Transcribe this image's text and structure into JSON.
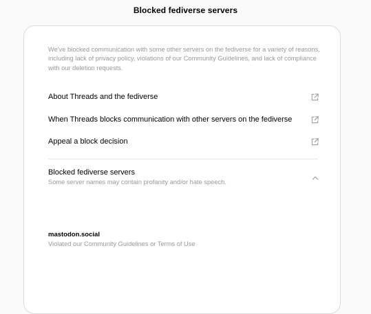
{
  "header": {
    "title": "Blocked fediverse servers"
  },
  "intro": "We've blocked communication with some other servers on the fediverse for a variety of reasons, including lack of privacy policy, violations of our Community Guidelines, and lack of compliance with our deletion requests.",
  "links": [
    {
      "label": "About Threads and the fediverse",
      "icon": "external-link-icon"
    },
    {
      "label": "When Threads blocks communication with other servers on the fediverse",
      "icon": "external-link-icon"
    },
    {
      "label": "Appeal a block decision",
      "icon": "external-link-icon"
    }
  ],
  "blocked_section": {
    "title": "Blocked fediverse servers",
    "subtitle": "Some server names may contain profanity and/or hate speech.",
    "expanded": true,
    "icon": "chevron-up-icon",
    "servers": [
      {
        "name": "mastodon.social",
        "reason": "Violated our Community Guidelines or Terms of Use"
      }
    ]
  },
  "colors": {
    "background": "#fafafa",
    "card": "#ffffff",
    "border": "#dbdbdb",
    "muted_text": "#999999",
    "icon": "#999999"
  }
}
